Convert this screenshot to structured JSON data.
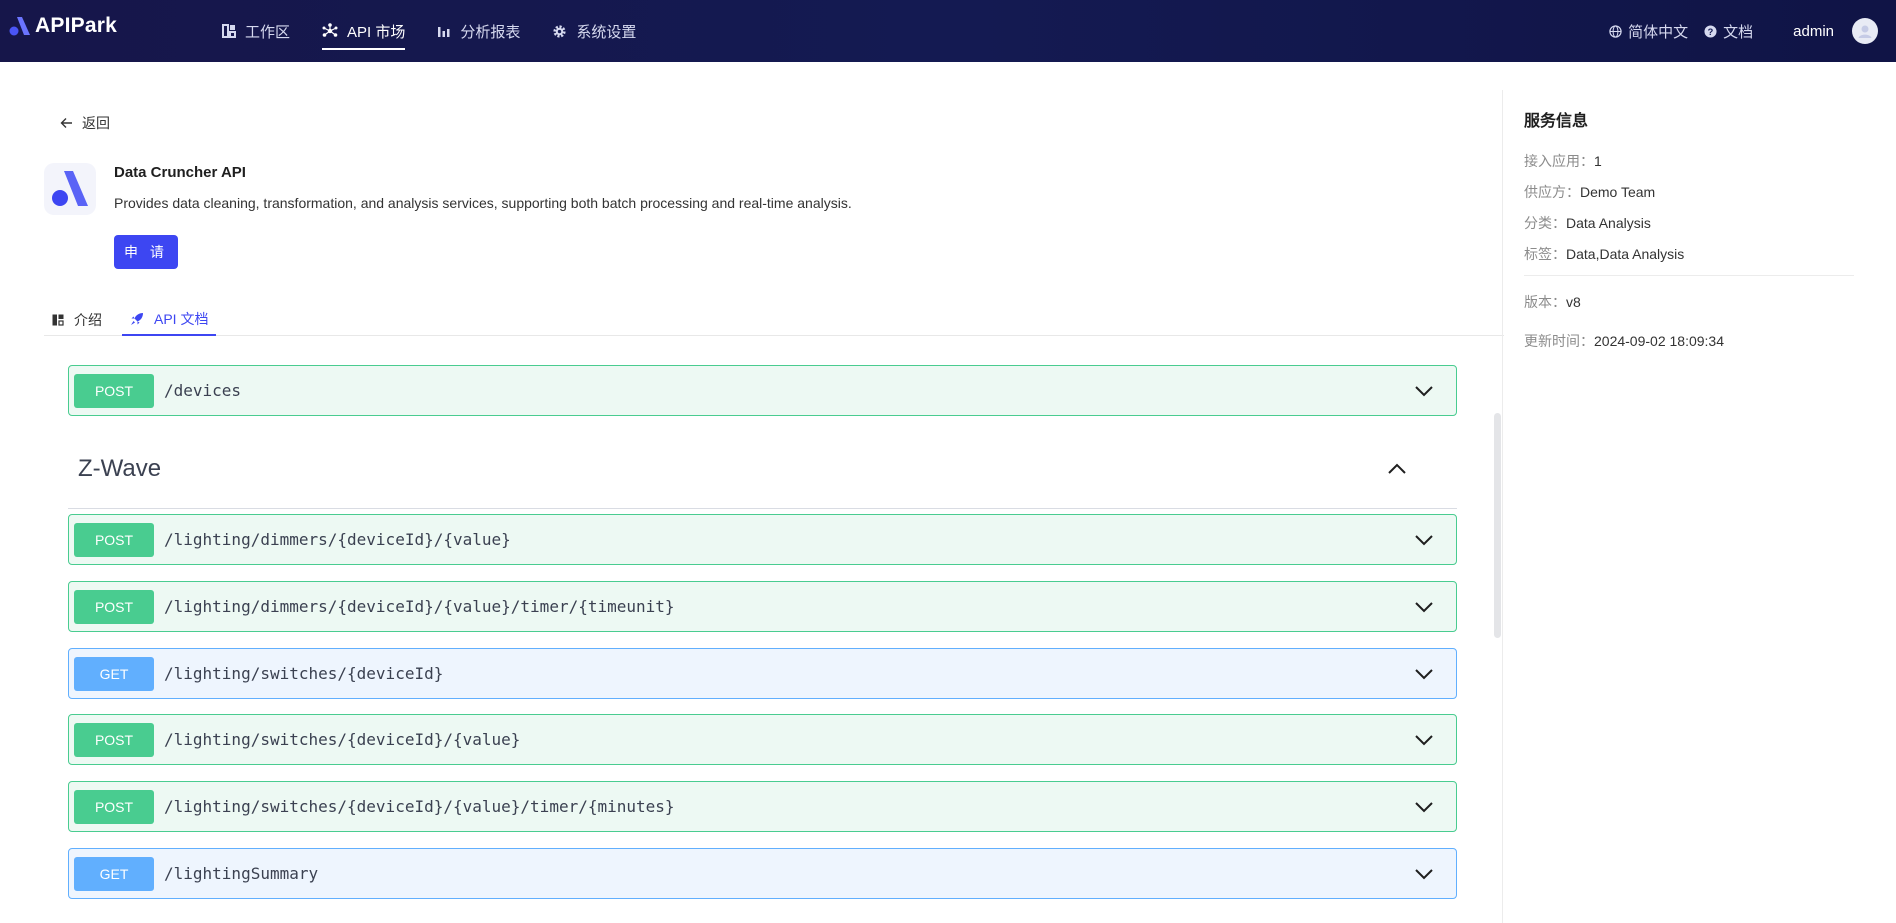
{
  "app": {
    "logo_text": "APIPark"
  },
  "nav": {
    "items": [
      {
        "label": "工作区",
        "icon": "dashboard-icon"
      },
      {
        "label": "API 市场",
        "icon": "market-icon",
        "active": true
      },
      {
        "label": "分析报表",
        "icon": "bar-chart-icon"
      },
      {
        "label": "系统设置",
        "icon": "gear-icon"
      }
    ]
  },
  "header_right": {
    "language": "简体中文",
    "docs": "文档",
    "user": "admin"
  },
  "back_label": "返回",
  "service": {
    "name": "Data Cruncher API",
    "description": "Provides data cleaning, transformation, and analysis services, supporting both batch processing and real-time analysis.",
    "apply_label": "申 请"
  },
  "tabs": [
    {
      "label": "介绍",
      "icon": "layout-icon"
    },
    {
      "label": "API 文档",
      "icon": "rocket-icon",
      "active": true
    }
  ],
  "operations_top": [
    {
      "method": "POST",
      "path": "/devices"
    }
  ],
  "section": {
    "title": "Z-Wave",
    "operations": [
      {
        "method": "POST",
        "path": "/lighting/dimmers/{deviceId}/{value}"
      },
      {
        "method": "POST",
        "path": "/lighting/dimmers/{deviceId}/{value}/timer/{timeunit}"
      },
      {
        "method": "GET",
        "path": "/lighting/switches/{deviceId}"
      },
      {
        "method": "POST",
        "path": "/lighting/switches/{deviceId}/{value}"
      },
      {
        "method": "POST",
        "path": "/lighting/switches/{deviceId}/{value}/timer/{minutes}"
      },
      {
        "method": "GET",
        "path": "/lightingSummary"
      }
    ]
  },
  "side_panel": {
    "title": "服务信息",
    "rows": [
      {
        "key": "接入应用：",
        "value": "1"
      },
      {
        "key": "供应方：",
        "value": "Demo Team"
      },
      {
        "key": "分类：",
        "value": "Data Analysis"
      },
      {
        "key": "标签：",
        "value": "Data,Data Analysis"
      },
      {
        "key": "版本：",
        "value": "v8"
      },
      {
        "key": "更新时间：",
        "value": "2024-09-02 18:09:34"
      }
    ]
  },
  "colors": {
    "accent": "#3d46f2",
    "post": "#49cc90",
    "get": "#61affe",
    "header_bg": "#16164a"
  }
}
